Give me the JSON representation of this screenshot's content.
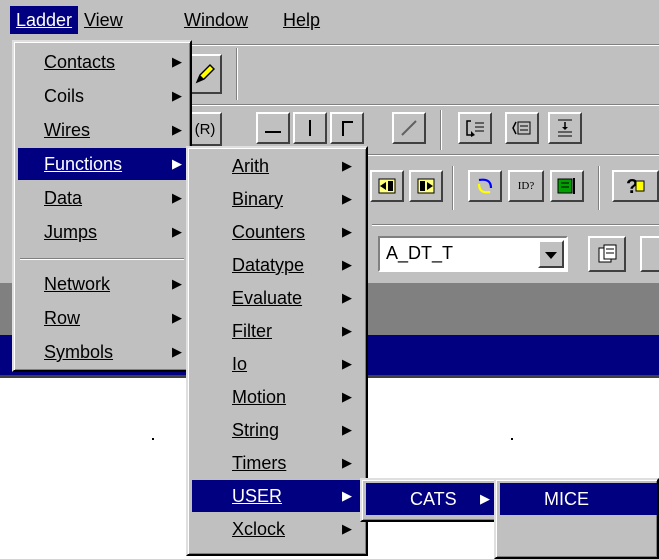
{
  "menubar": {
    "items": [
      {
        "label": "Ladder",
        "mnemonic": "L",
        "active": true
      },
      {
        "label": "View",
        "mnemonic": "V",
        "active": false
      },
      {
        "label": "Window",
        "mnemonic": "W",
        "active": false
      },
      {
        "label": "Help",
        "mnemonic": "H",
        "active": false
      }
    ]
  },
  "ladder_menu": {
    "items": [
      {
        "label": "Contacts",
        "mnemonic": "C",
        "submenu": true
      },
      {
        "label": "Coils",
        "mnemonic": "o",
        "submenu": true
      },
      {
        "label": "Wires",
        "mnemonic": "W",
        "submenu": true
      },
      {
        "label": "Functions",
        "mnemonic": "F",
        "submenu": true,
        "selected": true
      },
      {
        "label": "Data",
        "mnemonic": "D",
        "submenu": true
      },
      {
        "label": "Jumps",
        "mnemonic": "J",
        "submenu": true
      },
      {
        "label": "Network",
        "mnemonic": "N",
        "submenu": true
      },
      {
        "label": "Row",
        "mnemonic": "R",
        "submenu": true
      },
      {
        "label": "Symbols",
        "mnemonic": "S",
        "submenu": true
      }
    ]
  },
  "functions_menu": {
    "items": [
      {
        "label": "Arith",
        "mnemonic": "A",
        "submenu": true
      },
      {
        "label": "Binary",
        "mnemonic": "B",
        "submenu": true
      },
      {
        "label": "Counters",
        "mnemonic": "C",
        "submenu": true
      },
      {
        "label": "Datatype",
        "mnemonic": "D",
        "submenu": true
      },
      {
        "label": "Evaluate",
        "mnemonic": "E",
        "submenu": true
      },
      {
        "label": "Filter",
        "mnemonic": "F",
        "submenu": true
      },
      {
        "label": "Io",
        "mnemonic": "I",
        "submenu": true
      },
      {
        "label": "Motion",
        "mnemonic": "M",
        "submenu": true
      },
      {
        "label": "String",
        "mnemonic": "S",
        "submenu": true
      },
      {
        "label": "Timers",
        "mnemonic": "T",
        "submenu": true
      },
      {
        "label": "USER",
        "mnemonic": "U",
        "submenu": true,
        "selected": true
      },
      {
        "label": "Xclock",
        "mnemonic": "X",
        "submenu": true
      }
    ]
  },
  "user_menu": {
    "items": [
      {
        "label": "CATS",
        "submenu": true,
        "selected": true
      }
    ]
  },
  "cats_menu": {
    "items": [
      {
        "label": "MICE",
        "submenu": false,
        "selected": true
      }
    ]
  },
  "toolbar": {
    "combo_value": "A_DT_T",
    "reset_coil_glyph": "(R)",
    "id_button_glyph": "ID?"
  },
  "icons": {
    "submenu": "right-triangle-icon",
    "combo": "chevron-down-icon"
  },
  "colors": {
    "face": "#c0c0c0",
    "highlight": "#000080",
    "shadow": "#808080"
  }
}
